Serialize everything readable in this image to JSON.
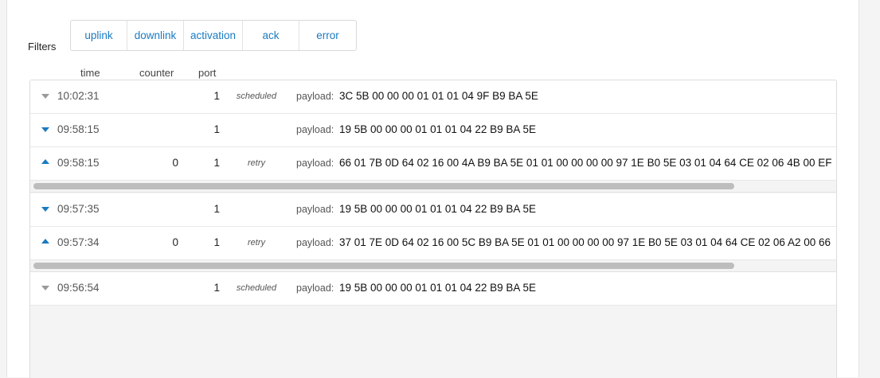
{
  "filters": {
    "label": "Filters",
    "buttons": [
      "uplink",
      "downlink",
      "activation",
      "ack",
      "error"
    ]
  },
  "columns": {
    "time": "time",
    "counter": "counter",
    "port": "port"
  },
  "payload_label": "payload:",
  "rows": [
    {
      "caret": "down-gray",
      "time": "10:02:31",
      "counter": "",
      "port": "1",
      "tag": "scheduled",
      "payload": "3C 5B 00 00 00 01 01 01 04 9F B9 BA 5E"
    },
    {
      "caret": "down-blue",
      "time": "09:58:15",
      "counter": "",
      "port": "1",
      "tag": "",
      "payload": "19 5B 00 00 00 01 01 01 04 22 B9 BA 5E"
    },
    {
      "caret": "up-blue",
      "time": "09:58:15",
      "counter": "0",
      "port": "1",
      "tag": "retry",
      "payload": "66 01 7B 0D 64 02 16 00 4A B9 BA 5E 01 01 00 00 00 00 97 1E B0 5E 03 01 04 64 CE 02 06 4B 00 EF"
    },
    {
      "caret": "down-blue",
      "time": "09:57:35",
      "counter": "",
      "port": "1",
      "tag": "",
      "payload": "19 5B 00 00 00 01 01 01 04 22 B9 BA 5E"
    },
    {
      "caret": "up-blue",
      "time": "09:57:34",
      "counter": "0",
      "port": "1",
      "tag": "retry",
      "payload": "37 01 7E 0D 64 02 16 00 5C B9 BA 5E 01 01 00 00 00 00 97 1E B0 5E 03 01 04 64 CE 02 06 A2 00 66"
    },
    {
      "caret": "down-gray",
      "time": "09:56:54",
      "counter": "",
      "port": "1",
      "tag": "scheduled",
      "payload": "19 5B 00 00 00 01 01 01 04 22 B9 BA 5E"
    }
  ],
  "colors": {
    "accent": "#1a7bc0",
    "caret_inactive": "#9a9a9a"
  }
}
